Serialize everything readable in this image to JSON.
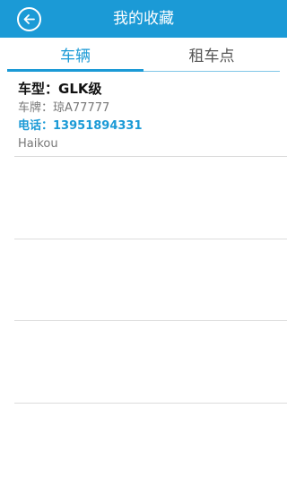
{
  "header": {
    "title": "我的收藏",
    "back_icon": "back-arrow-circle-icon"
  },
  "tabs": [
    {
      "label": "车辆",
      "active": true
    },
    {
      "label": "租车点",
      "active": false
    }
  ],
  "favorites": [
    {
      "model_label": "车型：",
      "model_value": "GLK级",
      "plate_label": "车牌：",
      "plate_value": "琼A77777",
      "phone_label": "电话：",
      "phone_value": "13951894331",
      "city": "Haikou"
    }
  ],
  "colors": {
    "accent": "#1b9ad6",
    "text_primary": "#111111",
    "text_secondary": "#777777",
    "divider": "#dcdcdc"
  }
}
